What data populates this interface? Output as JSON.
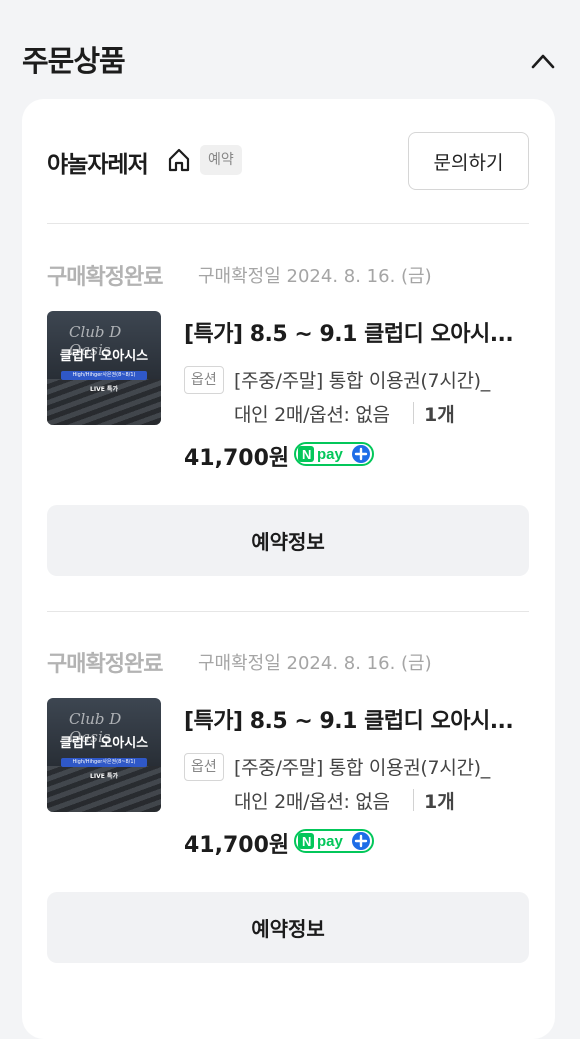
{
  "section": {
    "title": "주문상품"
  },
  "store": {
    "name": "야놀자레저",
    "badge": "예약",
    "inquiry_label": "문의하기"
  },
  "orders": [
    {
      "status": "구매확정완료",
      "confirm_date": "구매확정일 2024. 8. 16. (금)",
      "title": "[특가] 8.5 ~ 9.1 클럽디 오아시...",
      "option_tag": "옵션",
      "option_line1": "[주중/주말] 통합 이용권(7시간)_",
      "option_line2": "대인 2매/옵션: 없음",
      "quantity": "1개",
      "price": "41,700원",
      "reserve_label": "예약정보",
      "thumb": {
        "script": "Club D Oasis",
        "name": "클럽디 오아시스",
        "pill": "High/Hihger사은권(8~8/1)",
        "live": "LIVE 특가"
      }
    },
    {
      "status": "구매확정완료",
      "confirm_date": "구매확정일 2024. 8. 16. (금)",
      "title": "[특가] 8.5 ~ 9.1 클럽디 오아시...",
      "option_tag": "옵션",
      "option_line1": "[주중/주말] 통합 이용권(7시간)_",
      "option_line2": "대인 2매/옵션: 없음",
      "quantity": "1개",
      "price": "41,700원",
      "reserve_label": "예약정보",
      "thumb": {
        "script": "Club D Oasis",
        "name": "클럽디 오아시스",
        "pill": "High/Hihger사은권(8~8/1)",
        "live": "LIVE 특가"
      }
    }
  ],
  "npay": {
    "text": "pay",
    "color": "#03c75a"
  },
  "colors": {
    "background": "#f3f4f6",
    "card": "#ffffff",
    "status_gray": "#b3b3b3"
  },
  "icons": {
    "collapse": "chevron-up-icon",
    "store": "home-icon",
    "payment": "npay-plus-icon"
  }
}
